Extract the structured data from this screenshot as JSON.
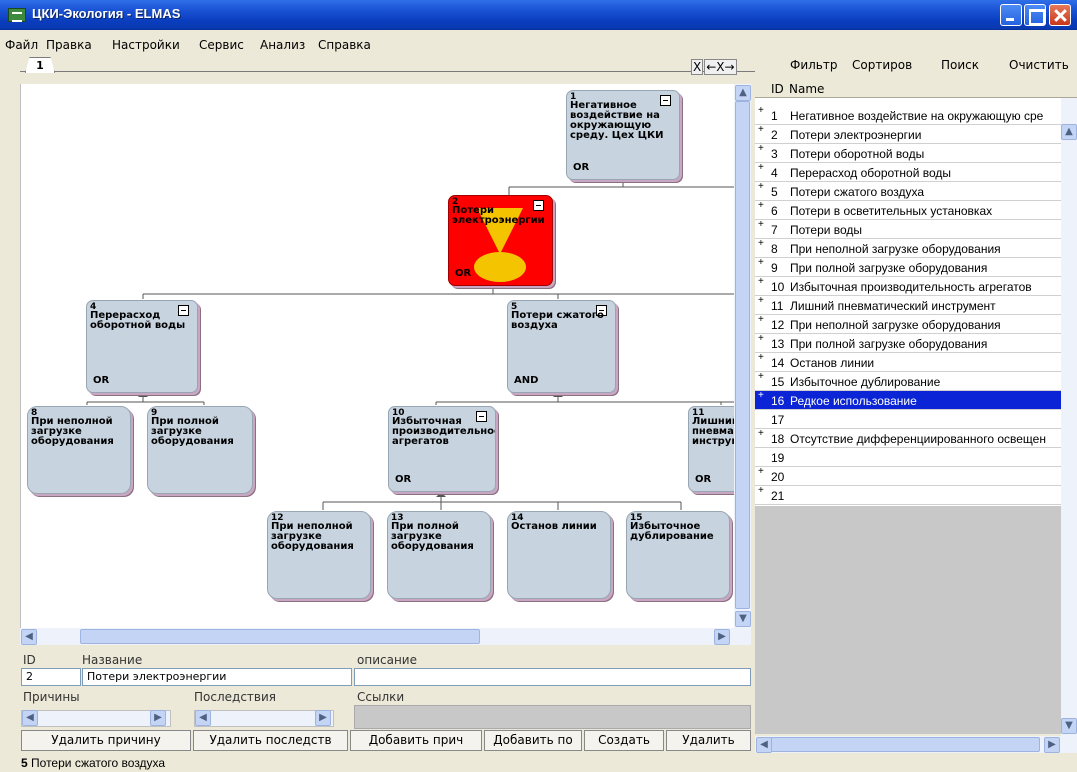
{
  "window": {
    "title": "ЦКИ-Экология - ELMAS"
  },
  "menu": [
    "Файл",
    "Правка",
    "Настройки",
    "Сервис",
    "Анализ",
    "Справка"
  ],
  "tab": {
    "label": "1"
  },
  "tree_controls": [
    "X",
    "←X→"
  ],
  "tree": {
    "nodes": [
      {
        "id": "1",
        "label": "Негативное воздействие на окружающую среду. Цех ЦКИ",
        "gate": "OR",
        "collapse": true
      },
      {
        "id": "2",
        "label": "Потери электроэнергии",
        "gate": "OR",
        "collapse": true,
        "selected": true
      },
      {
        "id": "4",
        "label": "Перерасход оборотной воды",
        "gate": "OR",
        "collapse": true
      },
      {
        "id": "5",
        "label": "Потери сжатого воздуха",
        "gate": "AND",
        "collapse": true
      },
      {
        "id": "8",
        "label": "При неполной загрузке оборудования",
        "gate": ""
      },
      {
        "id": "9",
        "label": "При полной загрузке оборудования",
        "gate": ""
      },
      {
        "id": "10",
        "label": "Избыточная производительность агрегатов",
        "gate": "OR",
        "collapse": true
      },
      {
        "id": "11",
        "label": "Лишний пневматический инструмент",
        "gate": "OR"
      },
      {
        "id": "12",
        "label": "При неполной загрузке оборудования",
        "gate": ""
      },
      {
        "id": "13",
        "label": "При полной загрузке оборудования",
        "gate": ""
      },
      {
        "id": "14",
        "label": "Останов линии",
        "gate": ""
      },
      {
        "id": "15",
        "label": "Избыточное дублирование",
        "gate": ""
      }
    ]
  },
  "props": {
    "id_label": "ID",
    "name_label": "Название",
    "desc_label": "описание",
    "id_value": "2",
    "name_value": "Потери электроэнергии",
    "causes_label": "Причины",
    "effects_label": "Последствия",
    "links_label": "Ссылки"
  },
  "buttons": {
    "delete_cause": "Удалить причину",
    "delete_effect": "Удалить последств",
    "add_cause": "Добавить прич",
    "add_effect": "Добавить по",
    "create": "Создать",
    "delete": "Удалить"
  },
  "right": {
    "filter": "Фильтр",
    "sort": "Сортиров",
    "search": "Поиск",
    "clear": "Очистить",
    "col_id": "ID",
    "col_name": "Name",
    "rows": [
      {
        "plus": "+",
        "id": "1",
        "name": "Негативное воздействие на окружающую сре"
      },
      {
        "plus": "+",
        "id": "2",
        "name": "Потери электроэнергии"
      },
      {
        "plus": "+",
        "id": "3",
        "name": "Потери оборотной воды"
      },
      {
        "plus": "+",
        "id": "4",
        "name": "Перерасход оборотной воды"
      },
      {
        "plus": "+",
        "id": "5",
        "name": "Потери сжатого воздуха"
      },
      {
        "plus": "+",
        "id": "6",
        "name": "Потери в осветительных установках"
      },
      {
        "plus": "+",
        "id": "7",
        "name": "Потери воды"
      },
      {
        "plus": "+",
        "id": "8",
        "name": "При неполной загрузке оборудования"
      },
      {
        "plus": "+",
        "id": "9",
        "name": "При полной загрузке оборудования"
      },
      {
        "plus": "+",
        "id": "10",
        "name": "Избыточная производительность агрегатов"
      },
      {
        "plus": "+",
        "id": "11",
        "name": "Лишний пневматический инструмент"
      },
      {
        "plus": "+",
        "id": "12",
        "name": "При неполной загрузке оборудования"
      },
      {
        "plus": "+",
        "id": "13",
        "name": "При полной загрузке оборудования"
      },
      {
        "plus": "+",
        "id": "14",
        "name": "Останов линии"
      },
      {
        "plus": "+",
        "id": "15",
        "name": "Избыточное дублирование"
      },
      {
        "plus": "+",
        "id": "16",
        "name": "Редкое использование",
        "selected": true
      },
      {
        "plus": "",
        "id": "17",
        "name": ""
      },
      {
        "plus": "+",
        "id": "18",
        "name": "Отсутствие дифференциированного освещен"
      },
      {
        "plus": "",
        "id": "19",
        "name": ""
      },
      {
        "plus": "+",
        "id": "20",
        "name": ""
      },
      {
        "plus": "+",
        "id": "21",
        "name": ""
      }
    ]
  },
  "status": {
    "num": "5",
    "text": "Потери сжатого воздуха"
  }
}
